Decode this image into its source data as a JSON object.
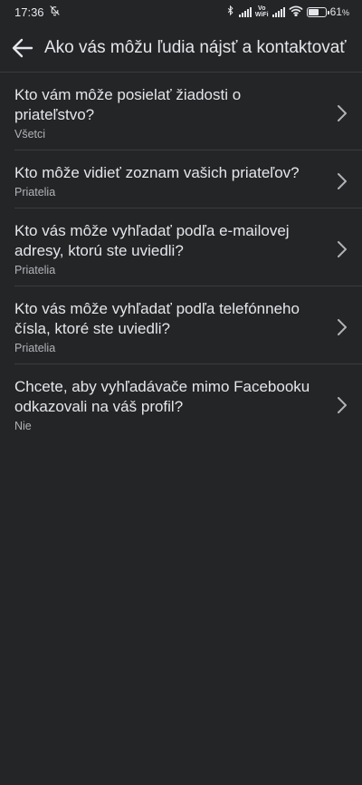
{
  "status_bar": {
    "time": "17:36",
    "battery_percent": "61",
    "battery_unit": "%",
    "vowifi_top": "Vo",
    "vowifi_bottom": "WiFi",
    "battery_level": 0.61
  },
  "header": {
    "title": "Ako vás môžu ľudia nájsť a kontaktovať"
  },
  "settings": [
    {
      "question": "Kto vám môže posielať žiadosti o priateľstvo?",
      "value": "Všetci"
    },
    {
      "question": "Kto môže vidieť zoznam vašich priateľov?",
      "value": "Priatelia"
    },
    {
      "question": "Kto vás môže vyhľadať podľa e-mailovej adresy, ktorú ste uviedli?",
      "value": "Priatelia"
    },
    {
      "question": "Kto vás môže vyhľadať podľa telefónneho čísla, ktoré ste uviedli?",
      "value": "Priatelia"
    },
    {
      "question": "Chcete, aby vyhľadávače mimo Facebooku odkazovali na váš profil?",
      "value": "Nie"
    }
  ],
  "colors": {
    "background": "#242526",
    "text_primary": "#e4e6eb",
    "text_secondary": "#b0b3b8",
    "divider": "#3a3b3c"
  }
}
